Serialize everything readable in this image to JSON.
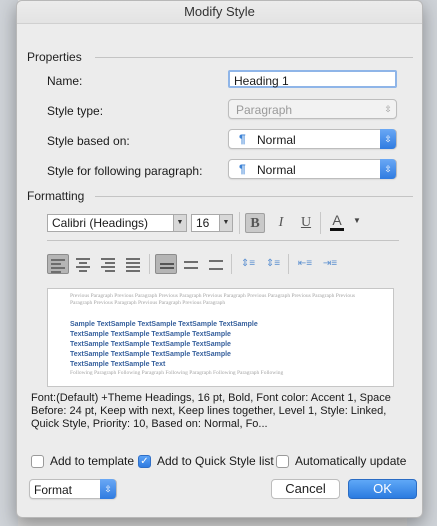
{
  "window": {
    "title": "Modify Style"
  },
  "properties": {
    "section_label": "Properties",
    "name_label": "Name:",
    "name_value": "Heading 1",
    "style_type_label": "Style type:",
    "style_type_value": "Paragraph",
    "based_on_label": "Style based on:",
    "based_on_value": "Normal",
    "following_label": "Style for following paragraph:",
    "following_value": "Normal"
  },
  "formatting": {
    "section_label": "Formatting",
    "font_name": "Calibri (Headings)",
    "font_size": "16",
    "bold_label": "B",
    "italic_label": "I",
    "underline_label": "U",
    "color_label": "A",
    "bold_active": true
  },
  "preview": {
    "previous_text": "Previous Paragraph Previous Paragraph Previous Paragraph Previous Paragraph Previous Paragraph Previous Paragraph Previous Paragraph Previous Paragraph Previous Paragraph Previous Paragraph",
    "sample_lines": [
      "Sample TextSample TextSample TextSample TextSample",
      "TextSample TextSample TextSample TextSample",
      "TextSample TextSample TextSample TextSample",
      "TextSample TextSample TextSample TextSample",
      "TextSample TextSample Text"
    ],
    "following_text": "Following Paragraph Following Paragraph Following Paragraph Following Paragraph Following"
  },
  "description": "Font:(Default) +Theme Headings, 16 pt, Bold, Font color: Accent 1, Space Before:  24 pt, Keep with next, Keep lines together, Level 1, Style: Linked, Quick Style, Priority: 10, Based on: Normal, Fo...",
  "options": {
    "add_to_template": {
      "label": "Add to template",
      "checked": false
    },
    "add_to_quick_style": {
      "label": "Add to Quick Style list",
      "checked": true
    },
    "auto_update": {
      "label": "Automatically update",
      "checked": false
    }
  },
  "footer": {
    "format_label": "Format",
    "cancel_label": "Cancel",
    "ok_label": "OK"
  },
  "colors": {
    "accent": "#2f7be0",
    "heading_sample": "#355f9c"
  }
}
